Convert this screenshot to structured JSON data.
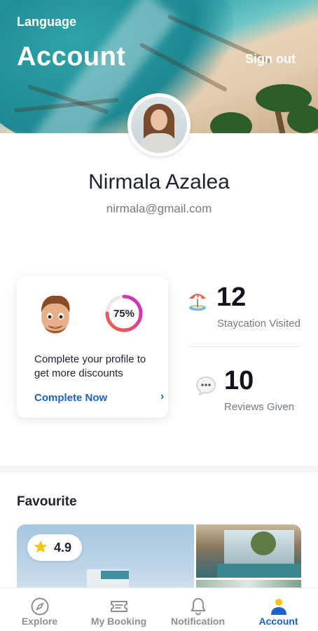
{
  "header": {
    "language_label": "Language",
    "title": "Account",
    "signout_label": "Sign out"
  },
  "profile": {
    "name": "Nirmala Azalea",
    "email": "nirmala@gmail.com"
  },
  "profile_card": {
    "completion_percent": 75,
    "completion_text": "75%",
    "message": "Complete your profile to get more discounts",
    "cta_label": "Complete Now",
    "cta_icon": "chevron-right-icon"
  },
  "stats": [
    {
      "icon": "beach-umbrella-icon",
      "value": "12",
      "label": "Staycation Visited"
    },
    {
      "icon": "speech-bubble-icon",
      "value": "10",
      "label": "Reviews Given"
    }
  ],
  "favourite": {
    "title": "Favourite",
    "rating": "4.9",
    "rating_icon": "star-icon"
  },
  "nav": {
    "items": [
      {
        "label": "Explore",
        "icon": "compass-icon",
        "active": false
      },
      {
        "label": "My Booking",
        "icon": "ticket-icon",
        "active": false
      },
      {
        "label": "Notification",
        "icon": "bell-icon",
        "active": false
      },
      {
        "label": "Account",
        "icon": "user-icon",
        "active": true
      }
    ]
  },
  "colors": {
    "accent": "#1b63c6",
    "ring_start": "#f2663a",
    "ring_end": "#c52fd0",
    "star": "#f5c518",
    "text_primary": "#1c2330",
    "text_secondary": "#737b86"
  }
}
